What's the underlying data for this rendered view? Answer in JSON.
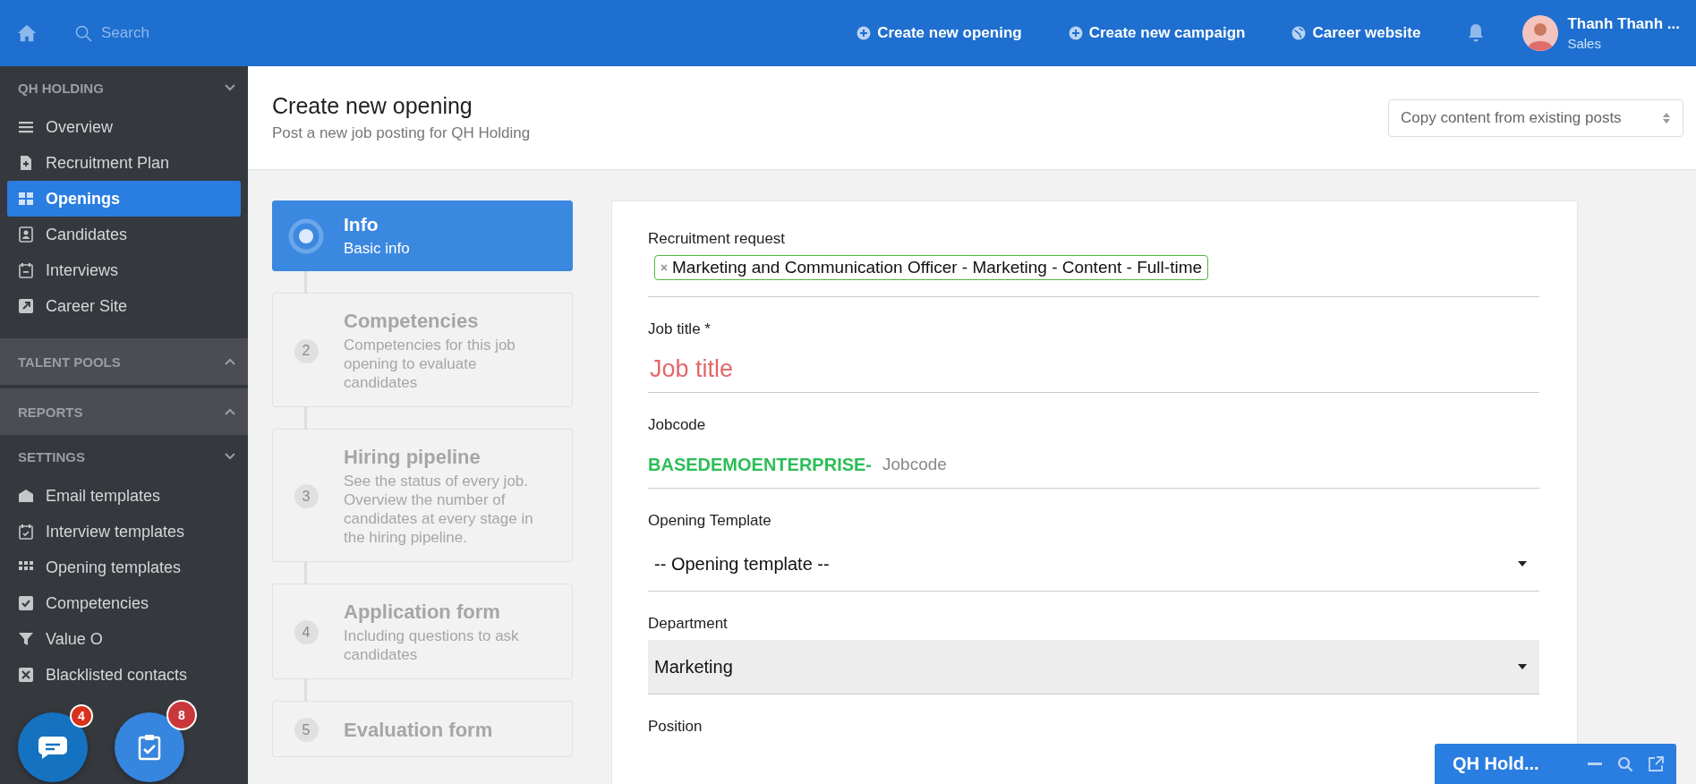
{
  "topbar": {
    "search": {
      "placeholder": "Search"
    },
    "links": [
      "Create new opening",
      "Create new campaign",
      "Career website"
    ],
    "user": {
      "name": "Thanh Thanh ...",
      "role": "Sales"
    }
  },
  "sidebar": {
    "sections": [
      {
        "title": "QH HOLDING",
        "expanded": true,
        "items": [
          {
            "label": "Overview",
            "selected": false
          },
          {
            "label": "Recruitment Plan",
            "selected": false
          },
          {
            "label": "Openings",
            "selected": true
          },
          {
            "label": "Candidates",
            "selected": false
          },
          {
            "label": "Interviews",
            "selected": false
          },
          {
            "label": "Career Site",
            "selected": false
          }
        ]
      },
      {
        "title": "TALENT POOLS",
        "expanded": false
      },
      {
        "title": "REPORTS",
        "expanded": false
      },
      {
        "title": "SETTINGS",
        "expanded": true,
        "items": [
          {
            "label": "Email templates",
            "selected": false
          },
          {
            "label": "Interview templates",
            "selected": false
          },
          {
            "label": "Opening templates",
            "selected": false
          },
          {
            "label": "Competencies",
            "selected": false
          },
          {
            "label": "Value O",
            "selected": false
          },
          {
            "label": "Blacklisted contacts",
            "selected": false
          }
        ]
      }
    ]
  },
  "header": {
    "title": "Create new opening",
    "subtitle": "Post a new job posting for QH Holding",
    "copy_select": {
      "placeholder": "Copy content from existing posts"
    }
  },
  "steps": [
    {
      "title": "Info",
      "description": "Basic info",
      "selected": true
    },
    {
      "number": "2",
      "title": "Competencies",
      "description": "Competencies for this job opening to evaluate candidates",
      "selected": false
    },
    {
      "number": "3",
      "title": "Hiring pipeline",
      "description": "See the status of every job. Overview the number of candidates at every stage in the hiring pipeline.",
      "selected": false
    },
    {
      "number": "4",
      "title": "Application form",
      "description": "Including questions to ask candidates",
      "selected": false
    },
    {
      "number": "5",
      "title": "Evaluation form",
      "selected": false
    }
  ],
  "form": {
    "fields": [
      {
        "kind": "tags",
        "label": "Recruitment request",
        "tags": [
          "Marketing and Communication Officer - Marketing - Content - Full-time"
        ]
      },
      {
        "kind": "text",
        "label": "Job title *",
        "placeholder": "Job title",
        "invalid": true
      },
      {
        "kind": "prefixed",
        "label": "Jobcode",
        "prefix": "BASEDEMOENTERPRISE-",
        "placeholder": "Jobcode"
      },
      {
        "kind": "select",
        "label": "Opening Template",
        "value": "-- Opening template --",
        "filled": false
      },
      {
        "kind": "select",
        "label": "Department",
        "value": "Marketing",
        "filled": true
      },
      {
        "label": "Position"
      }
    ]
  },
  "floating_buttons": [
    {
      "kind": "chat",
      "badge": "4"
    },
    {
      "kind": "tasks",
      "badge": "8"
    }
  ],
  "chat_widget": {
    "title": "QH Hold..."
  }
}
